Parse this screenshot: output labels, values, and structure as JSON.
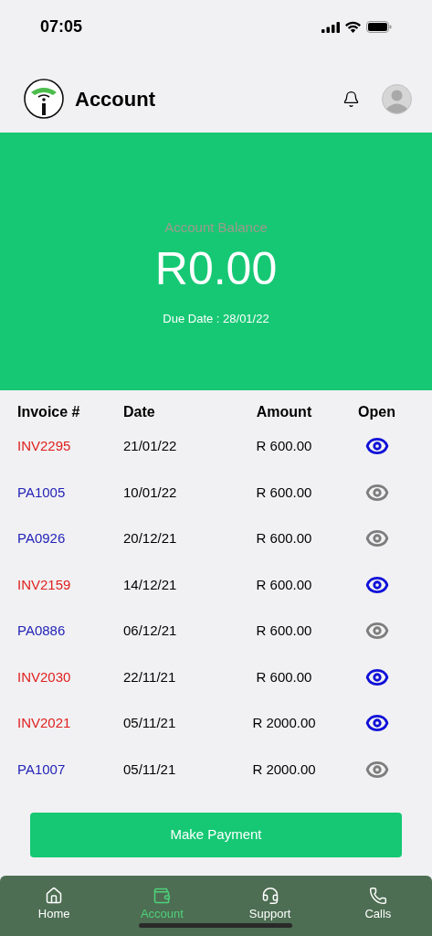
{
  "status_bar": {
    "time": "07:05"
  },
  "header": {
    "title": "Account"
  },
  "balance": {
    "label": "Account Balance",
    "amount": "R0.00",
    "due": "Due Date : 28/01/22"
  },
  "table": {
    "columns": [
      "Invoice #",
      "Date",
      "Amount",
      "Open"
    ],
    "rows": [
      {
        "kind": "invoice",
        "number": "INV2295",
        "date": "21/01/22",
        "amount": "R 600.00"
      },
      {
        "kind": "payment",
        "number": "PA1005",
        "date": "10/01/22",
        "amount": "R 600.00"
      },
      {
        "kind": "payment",
        "number": "PA0926",
        "date": "20/12/21",
        "amount": "R 600.00"
      },
      {
        "kind": "invoice",
        "number": "INV2159",
        "date": "14/12/21",
        "amount": "R 600.00"
      },
      {
        "kind": "payment",
        "number": "PA0886",
        "date": "06/12/21",
        "amount": "R 600.00"
      },
      {
        "kind": "invoice",
        "number": "INV2030",
        "date": "22/11/21",
        "amount": "R 600.00"
      },
      {
        "kind": "invoice",
        "number": "INV2021",
        "date": "05/11/21",
        "amount": "R 2000.00"
      },
      {
        "kind": "payment",
        "number": "PA1007",
        "date": "05/11/21",
        "amount": "R 2000.00"
      }
    ]
  },
  "action": {
    "label": "Make Payment"
  },
  "tab_bar": [
    {
      "kind": "home",
      "label": "Home",
      "selected": false
    },
    {
      "kind": "wallet",
      "label": "Account",
      "selected": true
    },
    {
      "kind": "support",
      "label": "Support",
      "selected": false
    },
    {
      "kind": "phone",
      "label": "Calls",
      "selected": false
    }
  ]
}
